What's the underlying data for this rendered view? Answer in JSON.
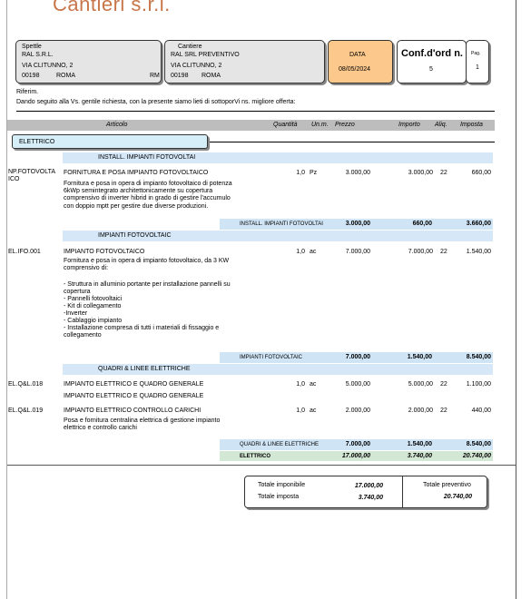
{
  "company": {
    "name": "Cantieri s.r.l."
  },
  "spettle": {
    "label": "Spettle",
    "lines": [
      "RAL S.R.L.",
      "VIA CLITUNNO, 2"
    ],
    "cap": "00198",
    "city": "ROMA",
    "prov": "RM"
  },
  "cantiere": {
    "label": "Cantiere",
    "lines": [
      "RAL SRL PREVENTIVO",
      "VIA CLITUNNO, 2"
    ],
    "cap": "00198",
    "city": "ROMA"
  },
  "data": {
    "label": "DATA",
    "value": "08/05/2024"
  },
  "conf": {
    "label": "Conf.d'ord n.",
    "value": "5"
  },
  "pag": {
    "label": "Pag.",
    "value": "1"
  },
  "riferim": "Riferim.",
  "intro": "Dando seguito alla Vs. gentile richiesta, con la presente siamo lieti di sottoporVi ns. migliore offerta:",
  "columns": {
    "articolo": "Articolo",
    "quantita": "Quantità",
    "um": "Un.m.",
    "prezzo": "Prezzo",
    "importo": "Importo",
    "aliq": "Aliq.",
    "imposta": "Imposta"
  },
  "category": "ELETTRICO",
  "sections": [
    {
      "title": "INSTALL. IMPIANTI FOTOVOLTAI"
    },
    {
      "title": "IMPIANTI FOTOVOLTAIC"
    },
    {
      "title": "QUADRI & LINEE ELETTRICHE"
    }
  ],
  "items": [
    {
      "code": "NP.FOTOVOLTAICO",
      "title": "FORNITURA E POSA IMPIANTO FOTOVOLTAICO",
      "desc": [
        "Fornitura e posa in opera di impianto fotovoltaico di potenza",
        "6kWp semintegrato architettonicamente su copertura",
        "comprensivo di inverter hibrid in grado di gestire l'accumulo",
        "con doppio mptt per gestire due diverse produzioni."
      ],
      "qty": "1,0",
      "um": "Pz",
      "price": "3.000,00",
      "amount": "3.000,00",
      "vat": "22",
      "tax": "660,00"
    },
    {
      "code": "EL.IFO.001",
      "title": "IMPIANTO FOTOVOLTAICO",
      "desc": [
        "Fornitura e posa in opera di impianto fotovoltaico, da 3 KW",
        "comprensivo di:",
        "",
        "- Struttura in alluminio portante per installazione pannelli su",
        "copertura",
        "- Pannelli fotovoltaici",
        "- Kit di collegamento",
        "-Inverter",
        "- Cablaggio impianto",
        "- Installazione compresa di tutti i materiali di fissaggio e",
        "collegamento"
      ],
      "qty": "1,0",
      "um": "ac",
      "price": "7.000,00",
      "amount": "7.000,00",
      "vat": "22",
      "tax": "1.540,00"
    },
    {
      "code": "EL.Q&L.018",
      "title": "IMPIANTO ELETTRICO E QUADRO GENERALE",
      "desc": [
        "IMPIANTO ELETTRICO E QUADRO GENERALE"
      ],
      "qty": "1,0",
      "um": "ac",
      "price": "5.000,00",
      "amount": "5.000,00",
      "vat": "22",
      "tax": "1.100,00"
    },
    {
      "code": "EL.Q&L.019",
      "title": "IMPIANTO ELETTRICO CONTROLLO CARICHI",
      "desc": [
        "Posa e fornitura centralina elettrica di gestione impianto",
        "elettrico e controllo carichi"
      ],
      "qty": "1,0",
      "um": "ac",
      "price": "2.000,00",
      "amount": "2.000,00",
      "vat": "22",
      "tax": "440,00"
    }
  ],
  "subtotals": [
    {
      "label": "INSTALL. IMPIANTI FOTOVOLTAI",
      "importo": "3.000,00",
      "imposta": "660,00",
      "totale": "3.660,00"
    },
    {
      "label": "IMPIANTI FOTOVOLTAIC",
      "importo": "7.000,00",
      "imposta": "1.540,00",
      "totale": "8.540,00"
    },
    {
      "label": "QUADRI & LINEE ELETTRICHE",
      "importo": "7.000,00",
      "imposta": "1.540,00",
      "totale": "8.540,00"
    },
    {
      "label": "ELETTRICO",
      "importo": "17.000,00",
      "imposta": "3.740,00",
      "totale": "20.740,00"
    }
  ],
  "totals": {
    "imponibile_label": "Totale imponibile",
    "imponibile": "17.000,00",
    "imposta_label": "Totale imposta",
    "imposta": "3.740,00",
    "preventivo_label": "Totale preventivo",
    "preventivo": "20.740,00"
  }
}
